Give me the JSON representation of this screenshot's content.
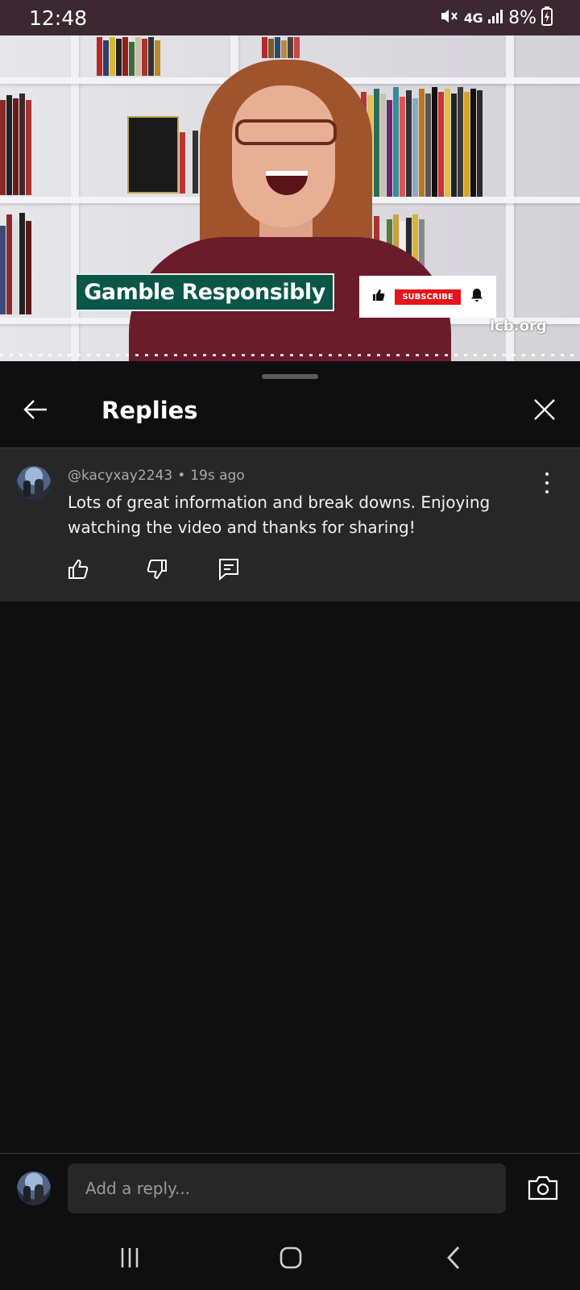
{
  "status_bar": {
    "time": "12:48",
    "network": "4G",
    "battery": "8%",
    "icons": [
      "mute-icon",
      "signal-icon",
      "battery-charging-icon"
    ]
  },
  "video": {
    "banner_text": "Gamble Responsibly",
    "subscribe_label": "SUBSCRIBE",
    "watermark": "lcb.org"
  },
  "header": {
    "title": "Replies",
    "back_icon": "arrow-left-icon",
    "close_icon": "close-icon"
  },
  "comment": {
    "author": "@kacyxay2243",
    "separator": "•",
    "time": "19s ago",
    "text": "Lots of great information and break downs. Enjoying watching the video and thanks for sharing!",
    "actions": [
      "like-icon",
      "dislike-icon",
      "reply-icon"
    ]
  },
  "reply_bar": {
    "placeholder": "Add a reply..."
  },
  "nav_bar": {
    "buttons": [
      "recents-icon",
      "home-icon",
      "back-icon"
    ]
  },
  "colors": {
    "background": "#0f0f0f",
    "comment_bg": "#272727",
    "status_bar": "#3b2830",
    "banner": "#0b5647",
    "subscribe": "#e8121a"
  }
}
